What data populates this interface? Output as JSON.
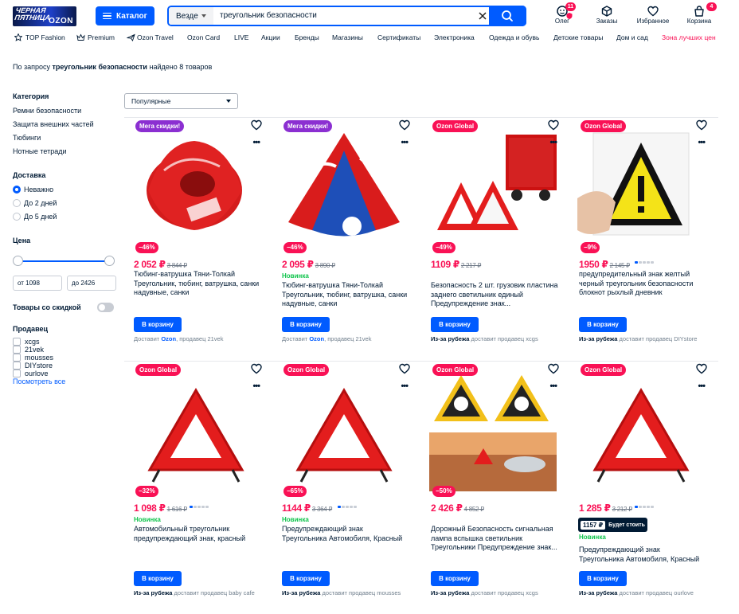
{
  "header": {
    "logo_line1": "ЧЕРНАЯ ПЯТНИЦА",
    "logo_line2": "OZON",
    "catalog_label": "Каталог",
    "search": {
      "scope": "Везде",
      "query": "треугольник безопасности"
    },
    "profile": {
      "label": "Олег",
      "badge": "11"
    },
    "orders": {
      "label": "Заказы"
    },
    "favorites": {
      "label": "Избранное"
    },
    "cart": {
      "label": "Корзина",
      "badge": "4"
    }
  },
  "nav": {
    "items": [
      "TOP Fashion",
      "Premium",
      "Ozon Travel",
      "Ozon Card",
      "LIVE",
      "Акции",
      "Бренды",
      "Магазины",
      "Сертификаты",
      "Электроника",
      "Одежда и обувь",
      "Детские товары",
      "Дом и сад",
      "Зона лучших цен"
    ]
  },
  "results": {
    "prefix": "По запросу",
    "query": "треугольник безопасности",
    "suffix": "найдено 8 товаров"
  },
  "sort": {
    "selected": "Популярные"
  },
  "filters": {
    "category": {
      "title": "Категория",
      "items": [
        "Ремни безопасности",
        "Защита внешних частей",
        "Тюбинги",
        "Нотные тетради"
      ]
    },
    "delivery": {
      "title": "Доставка",
      "options": [
        "Неважно",
        "До 2 дней",
        "До 5 дней"
      ],
      "selected": "Неважно"
    },
    "price": {
      "title": "Цена",
      "from": "от 1098",
      "to": "до 2426"
    },
    "discount_toggle": {
      "label": "Товары со скидкой",
      "on": false
    },
    "seller": {
      "title": "Продавец",
      "items": [
        "xcgs",
        "21vek",
        "mousses",
        "DIYstore",
        "ourlove"
      ],
      "show_all": "Посмотреть все"
    }
  },
  "products": [
    {
      "tag": "Мега скидки!",
      "discount": "−46%",
      "price": "2 052 ₽",
      "old_price": "3 844 ₽",
      "new": "",
      "title": "Тюбинг-ватрушка Тяни-Толкай Треугольник, тюбинг, ватрушка, санки надувные, санки",
      "buy": "В корзину",
      "ship_bold": "",
      "ship_text": "Доставит ",
      "ship_ozon": "Ozon",
      "ship_tail": ", продавец 21vek"
    },
    {
      "tag": "Мега скидки!",
      "discount": "−46%",
      "price": "2 095 ₽",
      "old_price": "3 890 ₽",
      "new": "Новинка",
      "title": "Тюбинг-ватрушка Тяни-Толкай Треугольник, тюбинг, ватрушка, санки надувные, санки",
      "buy": "В корзину",
      "ship_bold": "",
      "ship_text": "Доставит ",
      "ship_ozon": "Ozon",
      "ship_tail": ", продавец 21vek"
    },
    {
      "tag": "Ozon Global",
      "discount": "−49%",
      "price": "1109 ₽",
      "old_price": "2 217 ₽",
      "new": "Новинка",
      "title": "Безопасность 2 шт. грузовик пластина заднего светильник единый Предупреждение знак...",
      "buy": "В корзину",
      "ship_bold": "Из-за рубежа",
      "ship_text": " доставит продавец xcgs",
      "ship_ozon": "",
      "ship_tail": ""
    },
    {
      "tag": "Ozon Global",
      "discount": "−9%",
      "price": "1950 ₽",
      "old_price": "2 145 ₽",
      "new": "",
      "title": "предупредительный знак желтый черный треугольник безопасности блокнот рыхлый дневник",
      "buy": "В корзину",
      "ship_bold": "Из-за рубежа",
      "ship_text": " доставит продавец DIYstore",
      "ship_ozon": "",
      "ship_tail": ""
    },
    {
      "tag": "Ozon Global",
      "discount": "−32%",
      "price": "1 098 ₽",
      "old_price": "1 616 ₽",
      "new": "Новинка",
      "title": "Автомобильный треугольник предупреждающий знак, красный",
      "buy": "В корзину",
      "ship_bold": "Из-за рубежа",
      "ship_text": " доставит продавец baby cafe",
      "ship_ozon": "",
      "ship_tail": ""
    },
    {
      "tag": "Ozon Global",
      "discount": "−65%",
      "price": "1144 ₽",
      "old_price": "3 364 ₽",
      "new": "Новинка",
      "title": "Предупреждающий знак Треугольника Автомобиля, Красный",
      "buy": "В корзину",
      "ship_bold": "Из-за рубежа",
      "ship_text": " доставит продавец mousses",
      "ship_ozon": "",
      "ship_tail": ""
    },
    {
      "tag": "Ozon Global",
      "discount": "−50%",
      "price": "2 426 ₽",
      "old_price": "4 852 ₽",
      "new": "",
      "title": "Дорожный Безопасность сигнальная лампа вспышка светильник Треугольники Предупреждение знак...",
      "buy": "В корзину",
      "ship_bold": "Из-за рубежа",
      "ship_text": " доставит продавец xcgs",
      "ship_ozon": "",
      "ship_tail": ""
    },
    {
      "tag": "Ozon Global",
      "discount": "",
      "price": "1 285 ₽",
      "old_price": "3 212 ₽",
      "new": "Новинка",
      "title": "Предупреждающий знак Треугольника Автомобиля, Красный",
      "buy": "В корзину",
      "ship_bold": "Из-за рубежа",
      "ship_text": " доставит продавец ourlove",
      "ship_ozon": "",
      "ship_tail": "",
      "buyer_price": "1157 ₽",
      "buyer_label": "Будет стоить"
    }
  ],
  "colors": {
    "accent": "#005bff",
    "sale": "#f91155",
    "new": "#10c44c",
    "mega": "#8b2fd1"
  }
}
